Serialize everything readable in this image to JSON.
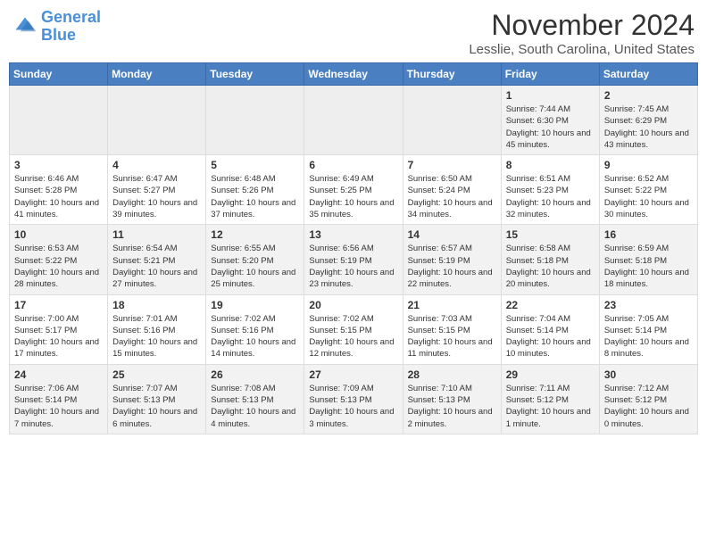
{
  "header": {
    "logo_line1": "General",
    "logo_line2": "Blue",
    "month_title": "November 2024",
    "location": "Lesslie, South Carolina, United States"
  },
  "weekdays": [
    "Sunday",
    "Monday",
    "Tuesday",
    "Wednesday",
    "Thursday",
    "Friday",
    "Saturday"
  ],
  "weeks": [
    [
      {
        "day": "",
        "info": ""
      },
      {
        "day": "",
        "info": ""
      },
      {
        "day": "",
        "info": ""
      },
      {
        "day": "",
        "info": ""
      },
      {
        "day": "",
        "info": ""
      },
      {
        "day": "1",
        "info": "Sunrise: 7:44 AM\nSunset: 6:30 PM\nDaylight: 10 hours and 45 minutes."
      },
      {
        "day": "2",
        "info": "Sunrise: 7:45 AM\nSunset: 6:29 PM\nDaylight: 10 hours and 43 minutes."
      }
    ],
    [
      {
        "day": "3",
        "info": "Sunrise: 6:46 AM\nSunset: 5:28 PM\nDaylight: 10 hours and 41 minutes."
      },
      {
        "day": "4",
        "info": "Sunrise: 6:47 AM\nSunset: 5:27 PM\nDaylight: 10 hours and 39 minutes."
      },
      {
        "day": "5",
        "info": "Sunrise: 6:48 AM\nSunset: 5:26 PM\nDaylight: 10 hours and 37 minutes."
      },
      {
        "day": "6",
        "info": "Sunrise: 6:49 AM\nSunset: 5:25 PM\nDaylight: 10 hours and 35 minutes."
      },
      {
        "day": "7",
        "info": "Sunrise: 6:50 AM\nSunset: 5:24 PM\nDaylight: 10 hours and 34 minutes."
      },
      {
        "day": "8",
        "info": "Sunrise: 6:51 AM\nSunset: 5:23 PM\nDaylight: 10 hours and 32 minutes."
      },
      {
        "day": "9",
        "info": "Sunrise: 6:52 AM\nSunset: 5:22 PM\nDaylight: 10 hours and 30 minutes."
      }
    ],
    [
      {
        "day": "10",
        "info": "Sunrise: 6:53 AM\nSunset: 5:22 PM\nDaylight: 10 hours and 28 minutes."
      },
      {
        "day": "11",
        "info": "Sunrise: 6:54 AM\nSunset: 5:21 PM\nDaylight: 10 hours and 27 minutes."
      },
      {
        "day": "12",
        "info": "Sunrise: 6:55 AM\nSunset: 5:20 PM\nDaylight: 10 hours and 25 minutes."
      },
      {
        "day": "13",
        "info": "Sunrise: 6:56 AM\nSunset: 5:19 PM\nDaylight: 10 hours and 23 minutes."
      },
      {
        "day": "14",
        "info": "Sunrise: 6:57 AM\nSunset: 5:19 PM\nDaylight: 10 hours and 22 minutes."
      },
      {
        "day": "15",
        "info": "Sunrise: 6:58 AM\nSunset: 5:18 PM\nDaylight: 10 hours and 20 minutes."
      },
      {
        "day": "16",
        "info": "Sunrise: 6:59 AM\nSunset: 5:18 PM\nDaylight: 10 hours and 18 minutes."
      }
    ],
    [
      {
        "day": "17",
        "info": "Sunrise: 7:00 AM\nSunset: 5:17 PM\nDaylight: 10 hours and 17 minutes."
      },
      {
        "day": "18",
        "info": "Sunrise: 7:01 AM\nSunset: 5:16 PM\nDaylight: 10 hours and 15 minutes."
      },
      {
        "day": "19",
        "info": "Sunrise: 7:02 AM\nSunset: 5:16 PM\nDaylight: 10 hours and 14 minutes."
      },
      {
        "day": "20",
        "info": "Sunrise: 7:02 AM\nSunset: 5:15 PM\nDaylight: 10 hours and 12 minutes."
      },
      {
        "day": "21",
        "info": "Sunrise: 7:03 AM\nSunset: 5:15 PM\nDaylight: 10 hours and 11 minutes."
      },
      {
        "day": "22",
        "info": "Sunrise: 7:04 AM\nSunset: 5:14 PM\nDaylight: 10 hours and 10 minutes."
      },
      {
        "day": "23",
        "info": "Sunrise: 7:05 AM\nSunset: 5:14 PM\nDaylight: 10 hours and 8 minutes."
      }
    ],
    [
      {
        "day": "24",
        "info": "Sunrise: 7:06 AM\nSunset: 5:14 PM\nDaylight: 10 hours and 7 minutes."
      },
      {
        "day": "25",
        "info": "Sunrise: 7:07 AM\nSunset: 5:13 PM\nDaylight: 10 hours and 6 minutes."
      },
      {
        "day": "26",
        "info": "Sunrise: 7:08 AM\nSunset: 5:13 PM\nDaylight: 10 hours and 4 minutes."
      },
      {
        "day": "27",
        "info": "Sunrise: 7:09 AM\nSunset: 5:13 PM\nDaylight: 10 hours and 3 minutes."
      },
      {
        "day": "28",
        "info": "Sunrise: 7:10 AM\nSunset: 5:13 PM\nDaylight: 10 hours and 2 minutes."
      },
      {
        "day": "29",
        "info": "Sunrise: 7:11 AM\nSunset: 5:12 PM\nDaylight: 10 hours and 1 minute."
      },
      {
        "day": "30",
        "info": "Sunrise: 7:12 AM\nSunset: 5:12 PM\nDaylight: 10 hours and 0 minutes."
      }
    ]
  ]
}
